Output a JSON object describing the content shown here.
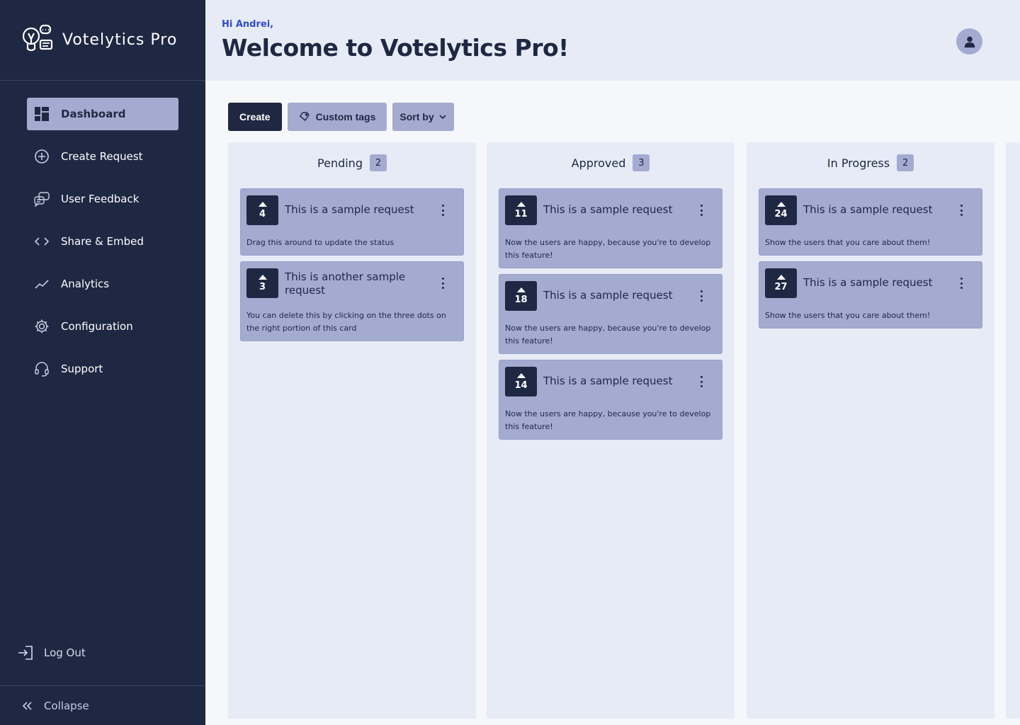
{
  "app": {
    "name": "Votelytics Pro"
  },
  "sidebar": {
    "items": [
      {
        "label": "Dashboard",
        "icon": "dashboard-icon",
        "active": true
      },
      {
        "label": "Create Request",
        "icon": "plus-circle-icon"
      },
      {
        "label": "User Feedback",
        "icon": "chat-bubbles-icon"
      },
      {
        "label": "Share & Embed",
        "icon": "code-brackets-icon"
      },
      {
        "label": "Analytics",
        "icon": "trend-line-icon"
      },
      {
        "label": "Configuration",
        "icon": "gear-icon"
      },
      {
        "label": "Support",
        "icon": "headset-icon"
      }
    ],
    "logout": "Log Out",
    "collapse": "Collapse"
  },
  "header": {
    "greeting": "Hi Andrei,",
    "title": "Welcome to Votelytics Pro!"
  },
  "toolbar": {
    "create": "Create",
    "custom_tags": "Custom tags",
    "sort_by": "Sort by"
  },
  "colors": {
    "navy": "#1e2843",
    "lavender": "#a3abd1",
    "panel": "#e7ebf6",
    "accent": "#2f4bd1"
  },
  "columns": [
    {
      "title": "Pending",
      "count": "2",
      "cards": [
        {
          "votes": "4",
          "title": "This is a sample request",
          "desc": "Drag this around to update the status"
        },
        {
          "votes": "3",
          "title": "This is another sample request",
          "desc": "You can delete this by clicking on the three dots on the right portion of this card"
        }
      ]
    },
    {
      "title": "Approved",
      "count": "3",
      "cards": [
        {
          "votes": "11",
          "title": "This is a sample request",
          "desc": "Now the users are happy, because you're to develop this feature!"
        },
        {
          "votes": "18",
          "title": "This is a sample request",
          "desc": "Now the users are happy, because you're to develop this feature!"
        },
        {
          "votes": "14",
          "title": "This is a sample request",
          "desc": "Now the users are happy, because you're to develop this feature!"
        }
      ]
    },
    {
      "title": "In Progress",
      "count": "2",
      "cards": [
        {
          "votes": "24",
          "title": "This is a sample request",
          "desc": "Show the users that you care about them!"
        },
        {
          "votes": "27",
          "title": "This is a sample request",
          "desc": "Show the users that you care about them!"
        }
      ]
    }
  ]
}
